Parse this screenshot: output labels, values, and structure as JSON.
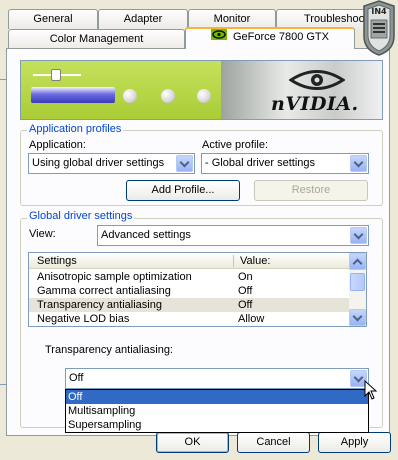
{
  "tabs_row1": [
    "General",
    "Adapter",
    "Monitor",
    "Troubleshoot"
  ],
  "tabs_row2": [
    "Color Management",
    "GeForce 7800 GTX"
  ],
  "badge_text": "IN4",
  "banner": {
    "logo_text": "nVIDIA."
  },
  "app_profiles": {
    "title": "Application profiles",
    "application_label": "Application:",
    "application_value": "Using global driver settings",
    "active_profile_label": "Active profile:",
    "active_profile_value": "- Global driver settings",
    "add_profile_label": "Add Profile...",
    "restore_label": "Restore"
  },
  "global_settings": {
    "title": "Global driver settings",
    "view_label": "View:",
    "view_value": "Advanced settings",
    "columns": [
      "Settings",
      "Value:"
    ],
    "rows": [
      {
        "setting": "Anisotropic sample optimization",
        "value": "On"
      },
      {
        "setting": "Gamma correct antialiasing",
        "value": "Off"
      },
      {
        "setting": "Transparency antialiasing",
        "value": "Off"
      },
      {
        "setting": "Negative LOD bias",
        "value": "Allow"
      }
    ],
    "selected_row": 2,
    "detail_label": "Transparency antialiasing:",
    "detail_value": "Off",
    "dropdown_options": [
      "Off",
      "Multisampling",
      "Supersampling"
    ],
    "dropdown_selected": 0
  },
  "buttons": {
    "ok": "OK",
    "cancel": "Cancel",
    "apply": "Apply"
  },
  "colors": {
    "accent": "#0046d5",
    "selection": "#316ac5",
    "nvidia_green": "#b8d64e"
  }
}
